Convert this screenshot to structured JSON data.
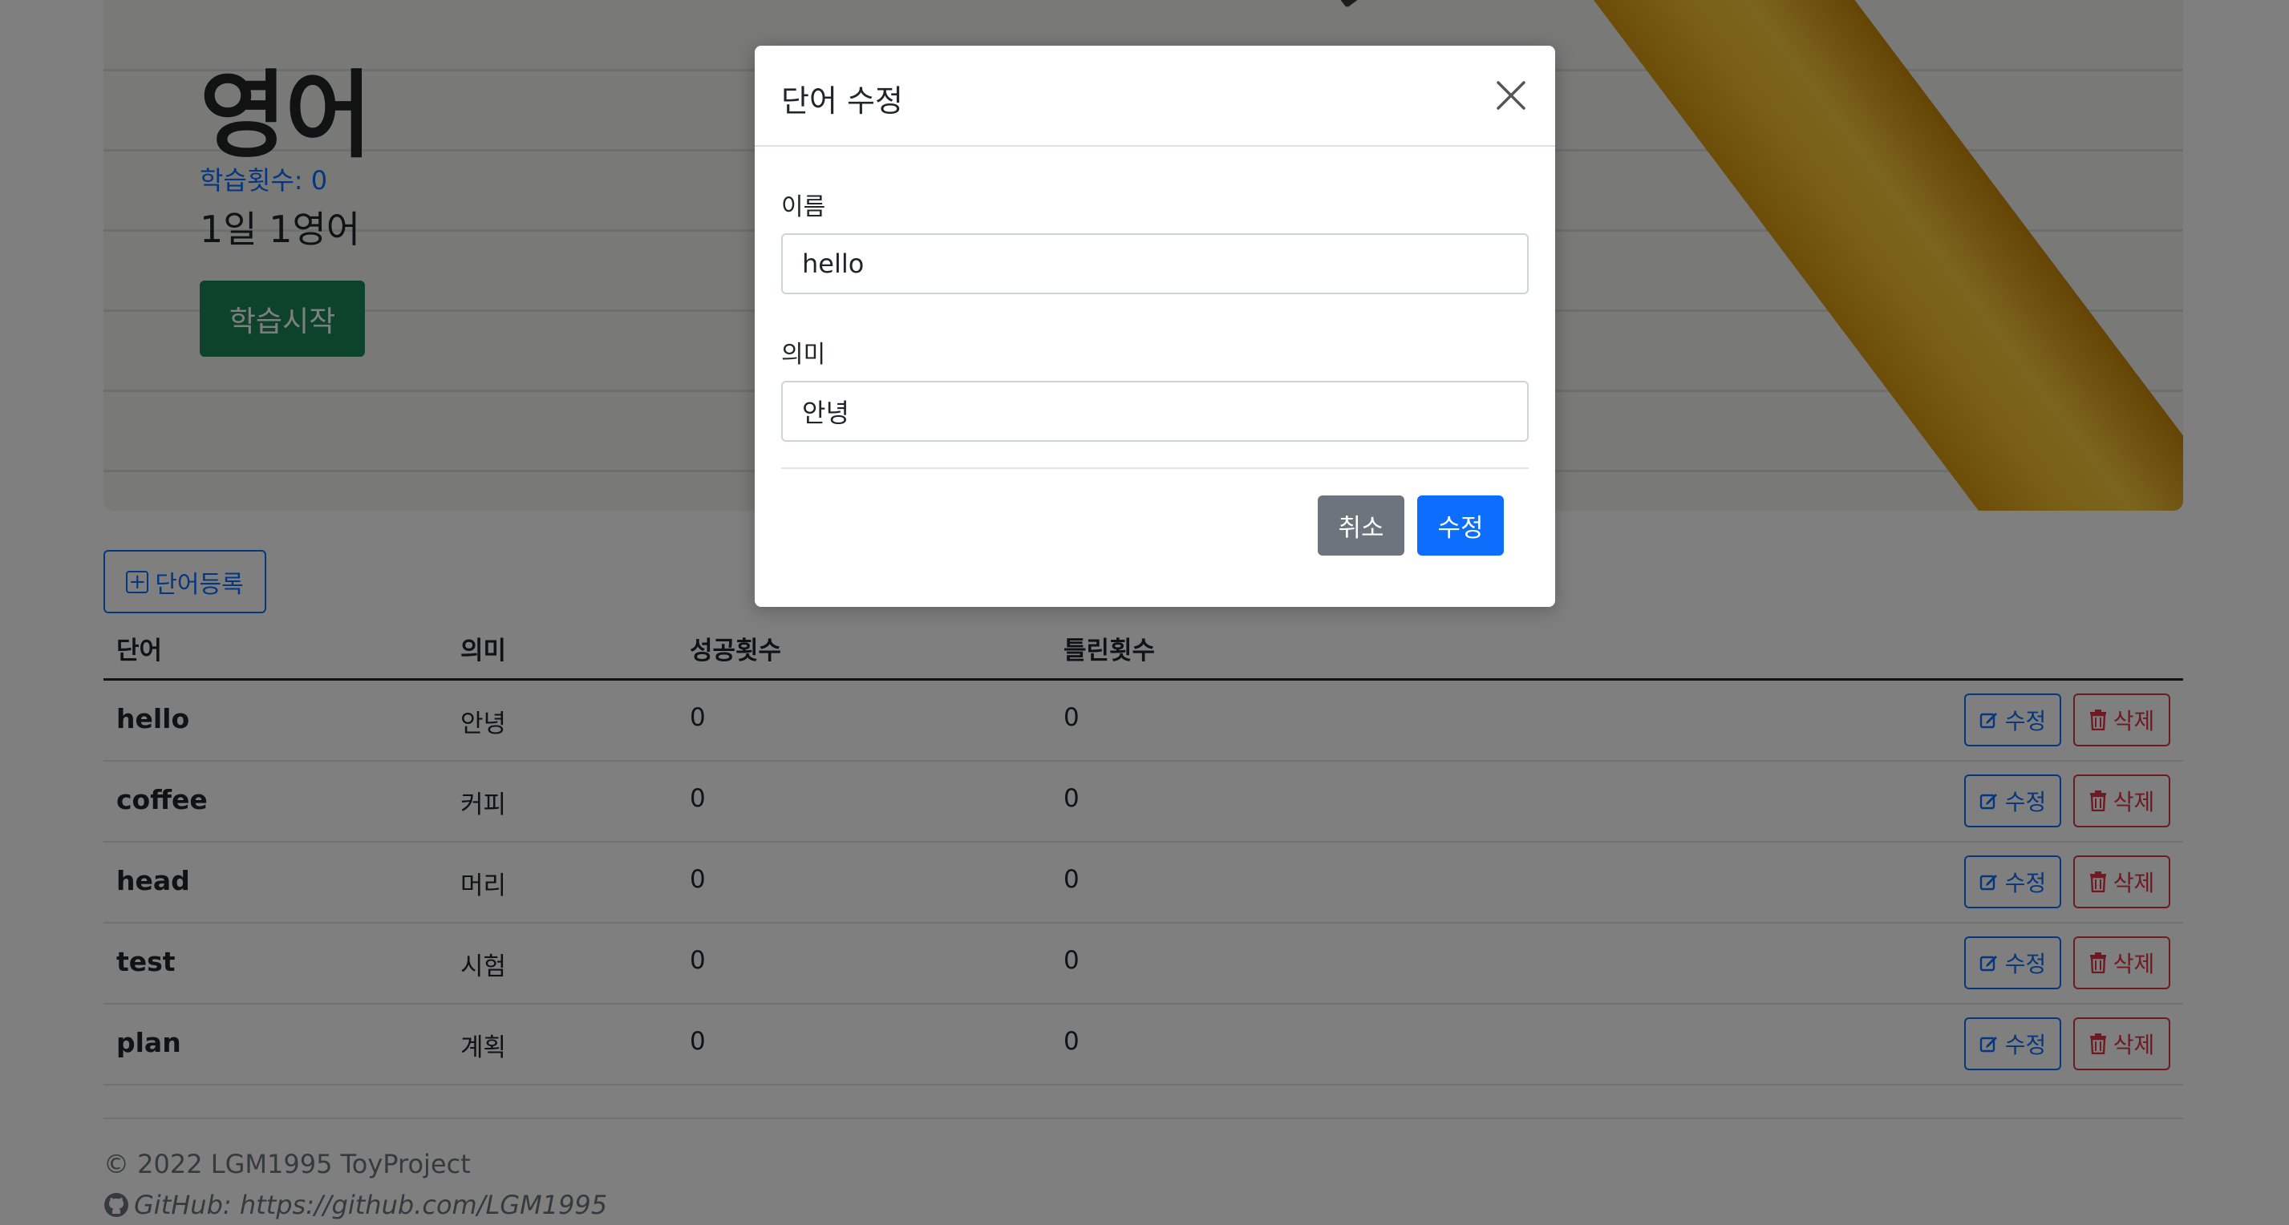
{
  "hero": {
    "title": "영어",
    "study_count": "학습횟수: 0",
    "description": "1일 1영어",
    "start_label": "학습시작"
  },
  "register": {
    "label": "단어등록",
    "icon": "plus-square-icon"
  },
  "table": {
    "headers": [
      "단어",
      "의미",
      "성공횟수",
      "틀린횟수"
    ],
    "rows": [
      {
        "word": "hello",
        "meaning": "안녕",
        "success": "0",
        "fail": "0"
      },
      {
        "word": "coffee",
        "meaning": "커피",
        "success": "0",
        "fail": "0"
      },
      {
        "word": "head",
        "meaning": "머리",
        "success": "0",
        "fail": "0"
      },
      {
        "word": "test",
        "meaning": "시험",
        "success": "0",
        "fail": "0"
      },
      {
        "word": "plan",
        "meaning": "계획",
        "success": "0",
        "fail": "0"
      }
    ],
    "edit_label": "수정",
    "delete_label": "삭제"
  },
  "footer": {
    "copyright": "© 2022 LGM1995 ToyProject",
    "github": "GitHub: https://github.com/LGM1995"
  },
  "modal": {
    "title": "단어 수정",
    "name_label": "이름",
    "name_value": "hello",
    "meaning_label": "의미",
    "meaning_value": "안녕",
    "cancel_label": "취소",
    "submit_label": "수정"
  },
  "colors": {
    "primary": "#0d6efd",
    "success": "#198754",
    "danger": "#dc3545",
    "secondary": "#6c757d"
  }
}
